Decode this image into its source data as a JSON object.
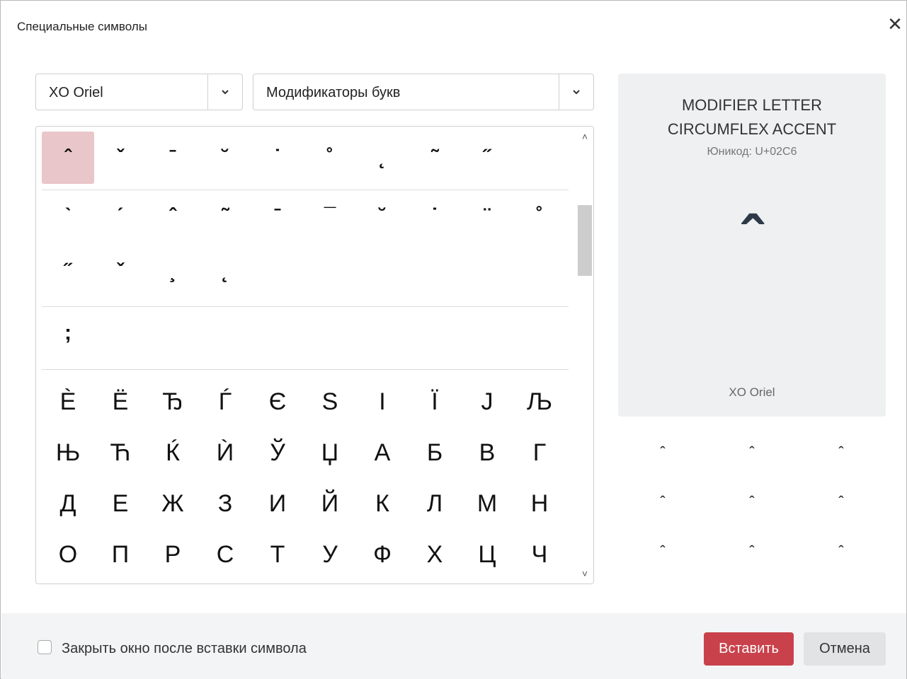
{
  "dialog": {
    "title": "Специальные символы",
    "close_glyph": "✕"
  },
  "font_select": {
    "value": "XO Oriel"
  },
  "category_select": {
    "value": "Модификаторы букв"
  },
  "grid": {
    "selected_symbol": "ˆ",
    "rows": [
      [
        "ˆ",
        "ˇ",
        "ˉ",
        "˘",
        "˙",
        "˚",
        "˛",
        "˜",
        "˝"
      ],
      [
        "ˋ",
        "ˊ",
        "ˆ",
        "˜",
        "ˉ",
        "¯",
        "˘",
        "˙",
        "¨",
        "˚"
      ],
      [
        "˝",
        "ˇ",
        "¸",
        "˛"
      ],
      [
        ";"
      ],
      [
        "Ѐ",
        "Ё",
        "Ђ",
        "Ѓ",
        "Є",
        "Ѕ",
        "І",
        "Ї",
        "Ј",
        "Љ"
      ],
      [
        "Њ",
        "Ћ",
        "Ќ",
        "Ѝ",
        "Ў",
        "Џ",
        "А",
        "Б",
        "В",
        "Г"
      ],
      [
        "Д",
        "Е",
        "Ж",
        "З",
        "И",
        "Й",
        "К",
        "Л",
        "М",
        "Н"
      ],
      [
        "О",
        "П",
        "Р",
        "С",
        "Т",
        "У",
        "Ф",
        "Х",
        "Ц",
        "Ч"
      ]
    ]
  },
  "preview": {
    "name": "MODIFIER LETTER CIRCUMFLEX ACCENT",
    "code": "Юникод: U+02C6",
    "glyph": "ˆ",
    "font": "XO Oriel"
  },
  "variants": [
    "ˆ",
    "ˆ",
    "ˆ",
    "ˆ",
    "ˆ",
    "ˆ",
    "ˆ",
    "ˆ",
    "ˆ"
  ],
  "footer": {
    "close_after_insert_label": "Закрыть окно после вставки символа",
    "close_after_insert_checked": false,
    "insert_label": "Вставить",
    "cancel_label": "Отмена"
  },
  "colors": {
    "accent": "#c9424b",
    "selected_cell": "#e9c6ca",
    "preview_bg": "#eef0f1"
  }
}
